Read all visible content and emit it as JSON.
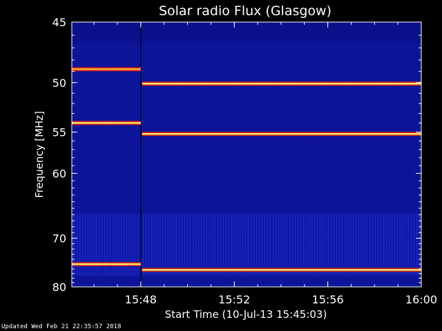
{
  "chart_data": {
    "type": "heatmap",
    "title": "Solar radio Flux (Glasgow)",
    "xlabel": "Start Time (10-Jul-13 15:45:03)",
    "ylabel": "Frequency [MHz]",
    "x_ticks": [
      "15:48",
      "15:52",
      "15:56",
      "16:00"
    ],
    "y_ticks": [
      "45",
      "50",
      "55",
      "60",
      "70",
      "80"
    ],
    "x_range": [
      "15:45:03",
      "16:00:00"
    ],
    "y_range_mhz": [
      45,
      80
    ],
    "y_scale": "reciprocal",
    "colormap": "blue-red-yellow",
    "data_gap_at": "15:48",
    "bright_lines": [
      {
        "segment": "before-15:48",
        "freq_mhz": 48.8,
        "intensity": "medium"
      },
      {
        "segment": "before-15:48",
        "freq_mhz": 54.0,
        "intensity": "high"
      },
      {
        "segment": "before-15:48",
        "freq_mhz": 75.0,
        "intensity": "high"
      },
      {
        "segment": "after-15:48",
        "freq_mhz": 50.1,
        "intensity": "high"
      },
      {
        "segment": "after-15:48",
        "freq_mhz": 55.2,
        "intensity": "high"
      },
      {
        "segment": "after-15:48",
        "freq_mhz": 76.2,
        "intensity": "high"
      }
    ]
  },
  "footer": {
    "updated": "Updated Wed Feb 21 22:35:57 2018"
  }
}
